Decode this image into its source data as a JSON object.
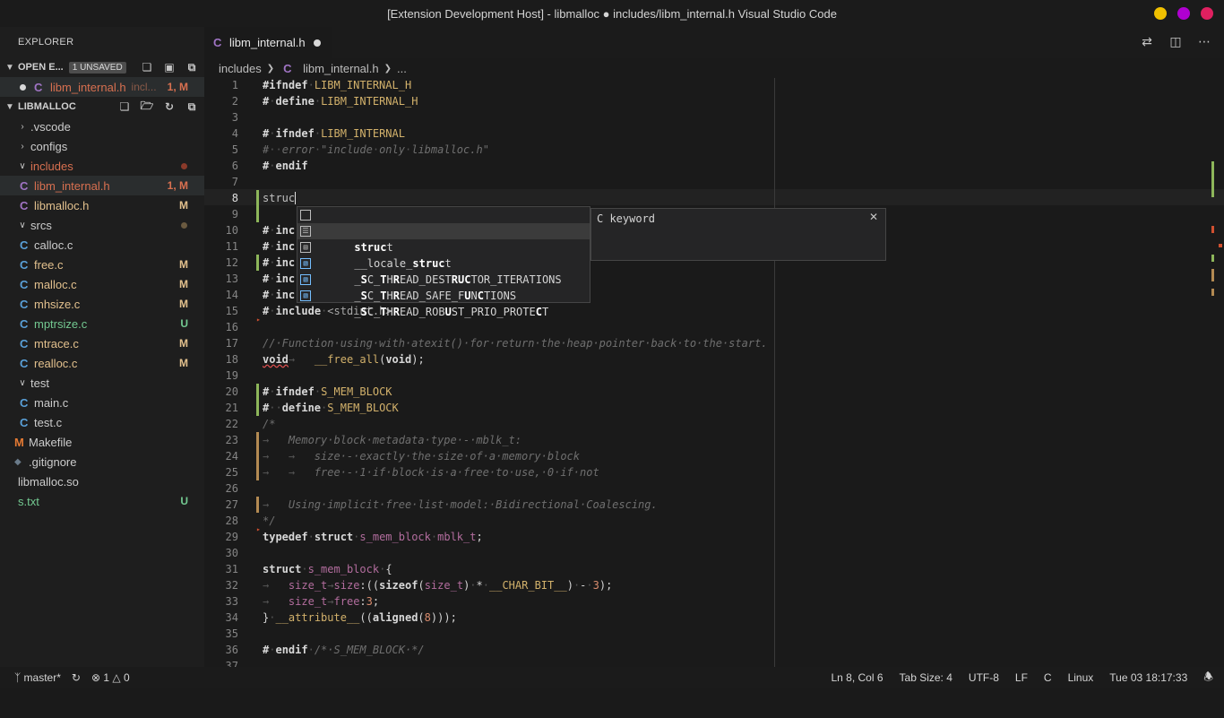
{
  "window": {
    "title": "[Extension Development Host] - libmalloc ● includes/libm_internal.h Visual Studio Code",
    "controls": [
      {
        "name": "minimize",
        "color": "#f0c000"
      },
      {
        "name": "maximize",
        "color": "#b000d0"
      },
      {
        "name": "close",
        "color": "#e02060"
      }
    ]
  },
  "sidebar": {
    "title": "EXPLORER",
    "open_editors": {
      "label": "OPEN E...",
      "badge": "1 UNSAVED",
      "item": {
        "name": "libm_internal.h",
        "path": "incl...",
        "status": "1, M"
      }
    },
    "root": {
      "label": "LIBMALLOC"
    },
    "tree": [
      {
        "kind": "folder",
        "name": ".vscode",
        "open": false
      },
      {
        "kind": "folder",
        "name": "configs",
        "open": false
      },
      {
        "kind": "folder",
        "name": "includes",
        "open": true,
        "color": "#d87050"
      },
      {
        "kind": "c-header",
        "name": "libm_internal.h",
        "status": "1, M",
        "color": "#d87050",
        "selected": true
      },
      {
        "kind": "c-header",
        "name": "libmalloc.h",
        "status": "M",
        "color": "#e2c08d"
      },
      {
        "kind": "folder",
        "name": "srcs",
        "open": true
      },
      {
        "kind": "c-file",
        "name": "calloc.c"
      },
      {
        "kind": "c-file",
        "name": "free.c",
        "status": "M",
        "color": "#e2c08d"
      },
      {
        "kind": "c-file",
        "name": "malloc.c",
        "status": "M",
        "color": "#e2c08d"
      },
      {
        "kind": "c-file",
        "name": "mhsize.c",
        "status": "M",
        "color": "#e2c08d"
      },
      {
        "kind": "c-file",
        "name": "mptrsize.c",
        "status": "U",
        "color": "#73c991"
      },
      {
        "kind": "c-file",
        "name": "mtrace.c",
        "status": "M",
        "color": "#e2c08d"
      },
      {
        "kind": "c-file",
        "name": "realloc.c",
        "status": "M",
        "color": "#e2c08d"
      },
      {
        "kind": "folder",
        "name": "test",
        "open": true
      },
      {
        "kind": "c-file",
        "name": "main.c"
      },
      {
        "kind": "c-file",
        "name": "test.c"
      },
      {
        "kind": "makefile",
        "name": "Makefile"
      },
      {
        "kind": "git",
        "name": ".gitignore"
      },
      {
        "kind": "plain",
        "name": "libmalloc.so"
      },
      {
        "kind": "plain",
        "name": "s.txt",
        "status": "U",
        "color": "#73c991"
      }
    ]
  },
  "tab": {
    "name": "libm_internal.h"
  },
  "breadcrumb": {
    "folder": "includes",
    "file": "libm_internal.h",
    "more": "..."
  },
  "suggest": {
    "items": [
      {
        "icon": "keyword",
        "text": "struct",
        "selected": false
      },
      {
        "icon": "snippet",
        "text": "struct",
        "selected": true
      },
      {
        "icon": "struct",
        "text": "__locale_struct",
        "selected": false
      },
      {
        "icon": "var",
        "text": "_SC_THREAD_DESTRUCTOR_ITERATIONS",
        "selected": false
      },
      {
        "icon": "var",
        "text": "_SC_THREAD_SAFE_FUNCTIONS",
        "selected": false
      },
      {
        "icon": "var",
        "text": "_SC_THREAD_ROBUST_PRIO_PROTECT",
        "selected": false
      }
    ],
    "detail": "C keyword"
  },
  "status": {
    "branch": "master*",
    "errors": "1",
    "warnings": "0",
    "cursor": "Ln 8, Col 6",
    "tab_size": "Tab Size: 4",
    "encoding": "UTF-8",
    "eol": "LF",
    "language": "C",
    "os": "Linux",
    "time": "Tue 03 18:17:33"
  }
}
